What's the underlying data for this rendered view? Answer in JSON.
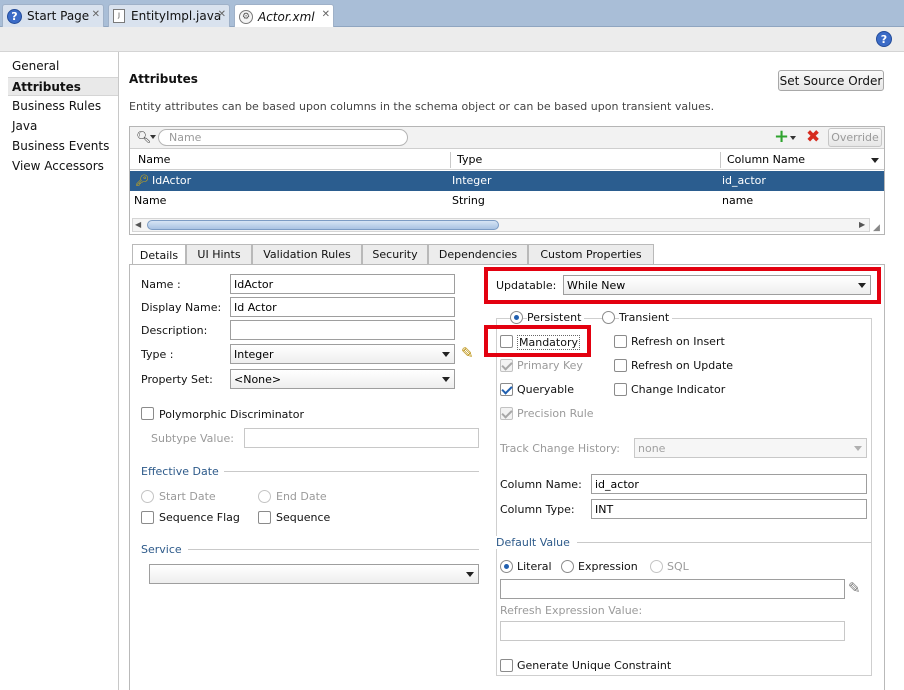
{
  "editor_tabs": [
    {
      "label": "Start Page",
      "icon": "help-icon"
    },
    {
      "label": "EntityImpl.java",
      "icon": "java-file-icon"
    },
    {
      "label": "Actor.xml",
      "icon": "xml-file-icon"
    }
  ],
  "nav": {
    "items": [
      "General",
      "Attributes",
      "Business Rules",
      "Java",
      "Business Events",
      "View Accessors"
    ],
    "selected": "Attributes"
  },
  "main": {
    "title": "Attributes",
    "description": "Entity attributes can be based upon columns in the schema object or can be based upon transient values.",
    "set_source_order": "Set Source Order",
    "search_placeholder": "Name",
    "override": "Override"
  },
  "table": {
    "columns": [
      "Name",
      "Type",
      "Column Name"
    ],
    "rows": [
      {
        "name": "IdActor",
        "type": "Integer",
        "column": "id_actor",
        "selected": true,
        "key": true
      },
      {
        "name": "Name",
        "type": "String",
        "column": "name",
        "selected": false,
        "key": false
      }
    ]
  },
  "detail_tabs": [
    "Details",
    "UI Hints",
    "Validation Rules",
    "Security",
    "Dependencies",
    "Custom Properties"
  ],
  "details": {
    "name_label": "Name :",
    "name_value": "IdActor",
    "display_label": "Display Name:",
    "display_value": "Id Actor",
    "description_label": "Description:",
    "description_value": "",
    "type_label": "Type :",
    "type_value": "Integer",
    "property_set_label": "Property Set:",
    "property_set_value": "<None>",
    "polymorphic": "Polymorphic Discriminator",
    "subtype_label": "Subtype Value:",
    "effective_date": "Effective Date",
    "start_date": "Start Date",
    "end_date": "End Date",
    "sequence_flag": "Sequence Flag",
    "sequence": "Sequence",
    "service": "Service"
  },
  "right": {
    "updatable_label": "Updatable:",
    "updatable_value": "While New",
    "persistent": "Persistent",
    "transient": "Transient",
    "mandatory": "Mandatory",
    "primary_key": "Primary Key",
    "queryable": "Queryable",
    "precision_rule": "Precision Rule",
    "refresh_insert": "Refresh on Insert",
    "refresh_update": "Refresh on Update",
    "change_indicator": "Change Indicator",
    "track_label": "Track Change History:",
    "track_value": "none",
    "column_name_label": "Column Name:",
    "column_name_value": "id_actor",
    "column_type_label": "Column Type:",
    "column_type_value": "INT",
    "default_value": "Default Value",
    "literal": "Literal",
    "expression": "Expression",
    "sql": "SQL",
    "refresh_expr_label": "Refresh Expression Value:",
    "generate_unique": "Generate Unique Constraint"
  },
  "colors": {
    "highlight_red": "#e3000f",
    "selected_row": "#2b5d8f",
    "section_blue": "#2d5a8a"
  }
}
